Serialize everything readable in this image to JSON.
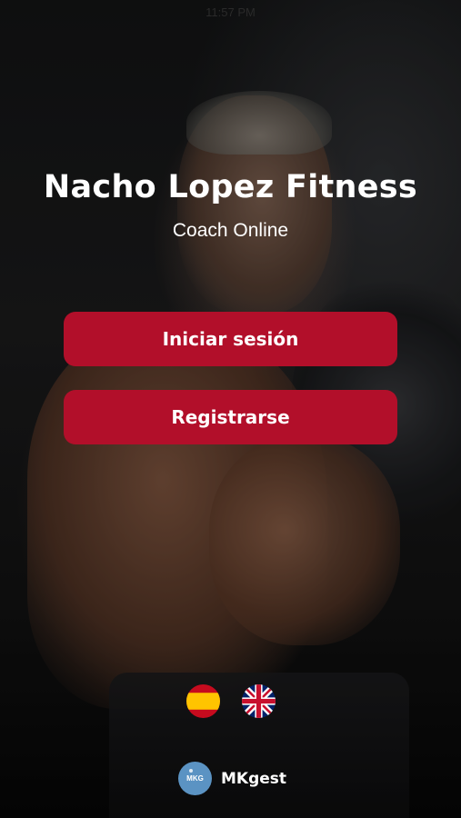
{
  "status_bar": {
    "time": "11:57 PM"
  },
  "header": {
    "title": "Nacho Lopez Fitness",
    "subtitle": "Coach Online"
  },
  "actions": {
    "login_label": "Iniciar sesión",
    "register_label": "Registrarse"
  },
  "languages": [
    {
      "icon": "spain-flag-icon",
      "code": "es"
    },
    {
      "icon": "uk-flag-icon",
      "code": "en"
    }
  ],
  "footer": {
    "logo_text": "MKG",
    "brand_name": "MKgest"
  },
  "colors": {
    "button": "#b20f2a",
    "brand_logo": "#5b93c3",
    "text": "#ffffff"
  }
}
